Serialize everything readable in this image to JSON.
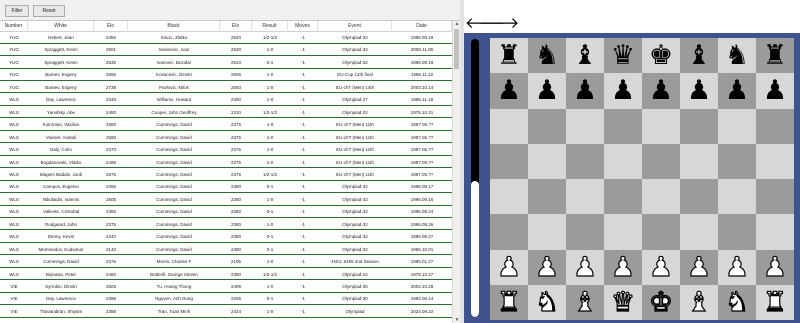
{
  "toolbar": {
    "filter_label": "Filter",
    "reset_label": "Reset"
  },
  "table": {
    "columns": [
      "Number",
      "White",
      "Elo",
      "Black",
      "Elo",
      "Result",
      "Moves",
      "Event",
      "Date"
    ],
    "rows": [
      [
        "YUG",
        "Hebert, Jean",
        "2455",
        "Sincic, Zlatko",
        "2520",
        "1/2-1/2",
        "-1",
        "Olympiad-32",
        "1996.09.19"
      ],
      [
        "YUG",
        "Spraggett, Kevin",
        "2501",
        "Ivanisevic, Ivan",
        "2530",
        "1-0",
        "-1",
        "Olympiad-34",
        "2000.11.06"
      ],
      [
        "YUG",
        "Spraggett, Kevin",
        "2535",
        "Ivanovic, Bozidar",
        "2510",
        "0-1",
        "-1",
        "Olympiad-32",
        "1996.09.19"
      ],
      [
        "YUG",
        "Bareev, Evgeny",
        "2655",
        "Kovacevic, Dimitri",
        "2505",
        "1-0",
        "-1",
        "EU-Cup 12th final",
        "1996.11.22"
      ],
      [
        "YUG",
        "Bareev, Evgeny",
        "2739",
        "Pavlovic, Milos",
        "2593",
        "1-0",
        "-1",
        "EU-chT (Men) 14th",
        "2003.10.14"
      ],
      [
        "WLS",
        "Day, Lawrence",
        "2330",
        "Williams, Howard",
        "2390",
        "1-0",
        "-1",
        "Olympiad-27",
        "1986.11.18"
      ],
      [
        "WLS",
        "Yanofsky, Abe",
        "2450",
        "Cooper, John Geoffrey",
        "2310",
        "1/2-1/2",
        "-1",
        "Olympiad-22",
        "1976.10.31"
      ],
      [
        "WLS",
        "Kotronias, Vasilios",
        "2580",
        "Cummings, David",
        "2375",
        "1-0",
        "-1",
        "EU-chT (Men) 11th",
        "1997.05.??"
      ],
      [
        "WLS",
        "Vaisser, Anatoli",
        "2580",
        "Cummings, David",
        "2375",
        "1-0",
        "-1",
        "EU-chT (Men) 11th",
        "1997.05.??"
      ],
      [
        "WLS",
        "Daly, Colm",
        "2370",
        "Cummings, David",
        "2375",
        "1-0",
        "-1",
        "EU-chT (Men) 11th",
        "1997.05.??"
      ],
      [
        "WLS",
        "Bogdanovski, Vlatko",
        "2495",
        "Cummings, David",
        "2375",
        "1-0",
        "-1",
        "EU-chT (Men) 11th",
        "1997.05.??"
      ],
      [
        "WLS",
        "Magem Badals, Jordi",
        "2575",
        "Cummings, David",
        "2375",
        "1/2-1/2",
        "-1",
        "EU-chT (Men) 11th",
        "1997.05.??"
      ],
      [
        "WLS",
        "Campos, Eugenio",
        "2255",
        "Cummings, David",
        "2380",
        "0-1",
        "-1",
        "Olympiad-32",
        "1996.09.17"
      ],
      [
        "WLS",
        "Nikolaidis, Ioannis",
        "2505",
        "Cummings, David",
        "2380",
        "1-0",
        "-1",
        "Olympiad-32",
        "1996.09.16"
      ],
      [
        "WLS",
        "Valiente, Cristobal",
        "2380",
        "Cummings, David",
        "2380",
        "0-1",
        "-1",
        "Olympiad-32",
        "1996.09.24"
      ],
      [
        "WLS",
        "Rodgaard, John",
        "2375",
        "Cummings, David",
        "2380",
        "1-0",
        "-1",
        "Olympiad-32",
        "1996.09.26"
      ],
      [
        "WLS",
        "Denny, Kevin",
        "2240",
        "Cummings, David",
        "2380",
        "0-1",
        "-1",
        "Olympiad-32",
        "1996.09.27"
      ],
      [
        "WLS",
        "Memmedov, Kudsanar",
        "2140",
        "Cummings, David",
        "2380",
        "0-1",
        "-1",
        "Olympiad-32",
        "1996.10.01"
      ],
      [
        "WLS",
        "Cummings, David",
        "2375",
        "Morris, Charles F",
        "2195",
        "1-0",
        "-1",
        "4NCL 9495 2nd Season",
        "1995.01.27"
      ],
      [
        "WLS",
        "Biyiasas, Peter",
        "2460",
        "Botterill, George Steven",
        "2390",
        "1/2-1/2",
        "-1",
        "Olympiad-22",
        "1976.10.27"
      ],
      [
        "VIE",
        "Syrrokin, Dimitri",
        "2505",
        "Tu, Hoang Thong",
        "2499",
        "1-0",
        "-1",
        "Olympiad-36",
        "2004.10.29"
      ],
      [
        "VIE",
        "Day, Lawrence",
        "2395",
        "Nguyen, Anh Dung",
        "2205",
        "0-1",
        "-1",
        "Olympiad-30",
        "1992.06.14"
      ],
      [
        "VIE",
        "Thavandiran, Shiyam",
        "2388",
        "Tran, Tuan Minh",
        "2424",
        "1-0",
        "-1",
        "Olympiad",
        "2024.09.22"
      ]
    ]
  },
  "nav": {
    "back_glyph": "🡐",
    "forward_glyph": "🡒"
  },
  "eval": {
    "white_fraction": 0.49
  },
  "board": {
    "ranks": [
      [
        "bR",
        "bN",
        "bB",
        "bQ",
        "bK",
        "bB",
        "bN",
        "bR"
      ],
      [
        "bP",
        "bP",
        "bP",
        "bP",
        "bP",
        "bP",
        "bP",
        "bP"
      ],
      [
        "",
        "",
        "",
        "",
        "",
        "",
        "",
        ""
      ],
      [
        "",
        "",
        "",
        "",
        "",
        "",
        "",
        ""
      ],
      [
        "",
        "",
        "",
        "",
        "",
        "",
        "",
        ""
      ],
      [
        "",
        "",
        "",
        "",
        "",
        "",
        "",
        ""
      ],
      [
        "wP",
        "wP",
        "wP",
        "wP",
        "wP",
        "wP",
        "wP",
        "wP"
      ],
      [
        "wR",
        "wN",
        "wB",
        "wQ",
        "wK",
        "wB",
        "wN",
        "wR"
      ]
    ]
  },
  "colors": {
    "board_light": "#d7d7d7",
    "board_dark": "#9b9b9b",
    "board_frame": "#3f548f",
    "row_border": "#2e6e2e"
  }
}
